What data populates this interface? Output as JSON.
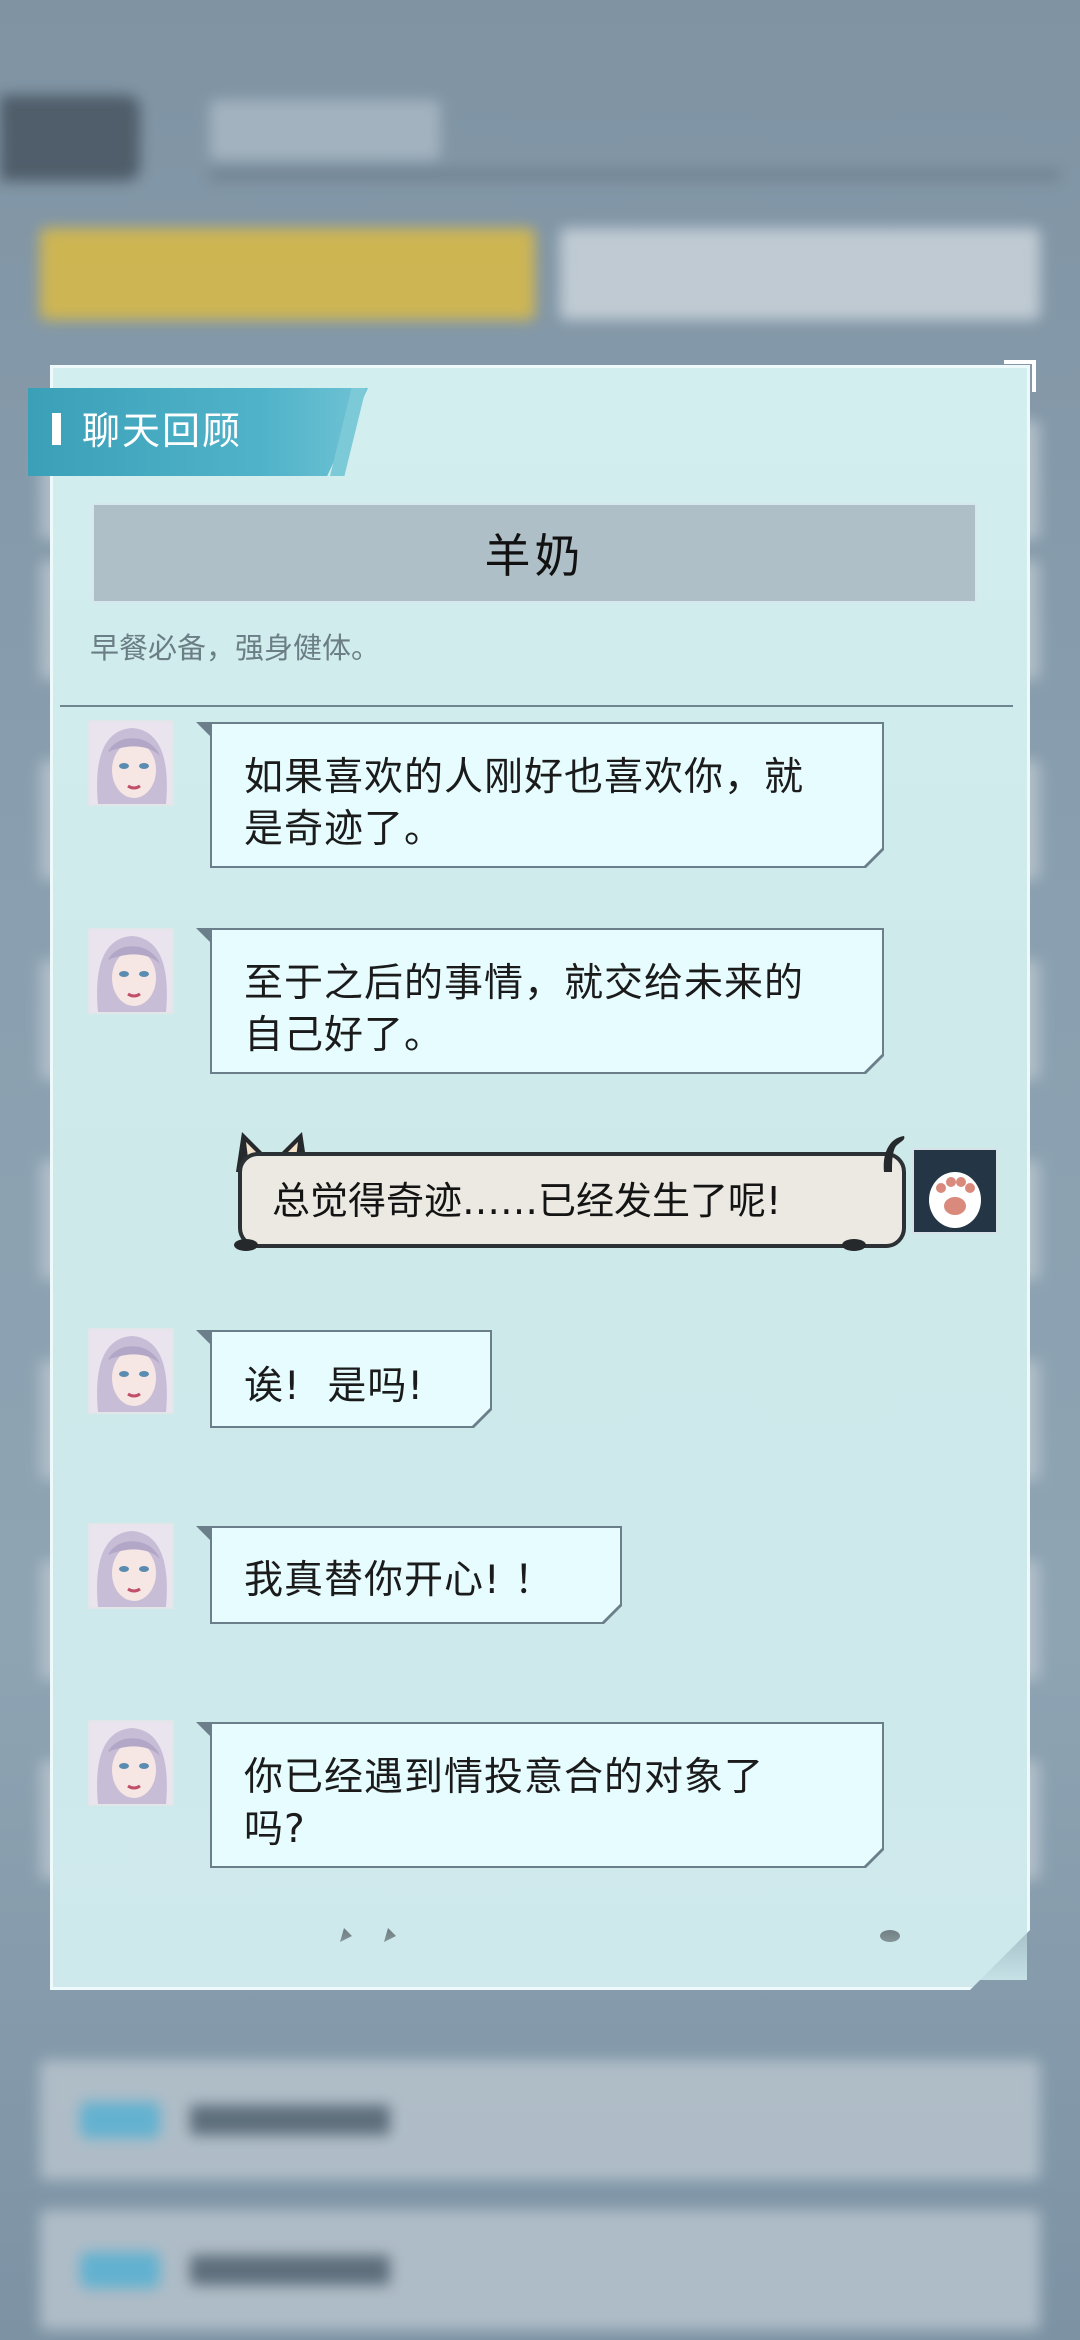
{
  "popup": {
    "title": "聊天回顾",
    "item_name": "羊奶",
    "item_desc": "早餐必备，强身健体。"
  },
  "messages": [
    {
      "speaker": "npc",
      "lines": [
        "如果喜欢的人刚好也喜欢你，就",
        "是奇迹了。"
      ]
    },
    {
      "speaker": "npc",
      "lines": [
        "至于之后的事情，就交给未来的",
        "自己好了。"
      ]
    },
    {
      "speaker": "player",
      "lines": [
        "总觉得奇迹……已经发生了呢!"
      ]
    },
    {
      "speaker": "npc",
      "lines": [
        "诶!  是吗!"
      ]
    },
    {
      "speaker": "npc",
      "lines": [
        "我真替你开心! ！"
      ]
    },
    {
      "speaker": "npc",
      "lines": [
        "你已经遇到情投意合的对象了",
        "吗?"
      ]
    }
  ],
  "colors": {
    "header_accent": "#3aa0b8",
    "npc_bubble": "#e6fcfe",
    "player_bubble": "#ebe9e2",
    "panel_bg": "#d3eeee"
  },
  "icons": {
    "npc_avatar": "silver-haired-girl-portrait",
    "player_avatar": "cat-paw-icon",
    "bubble_decoration": "black-cat-ears"
  }
}
